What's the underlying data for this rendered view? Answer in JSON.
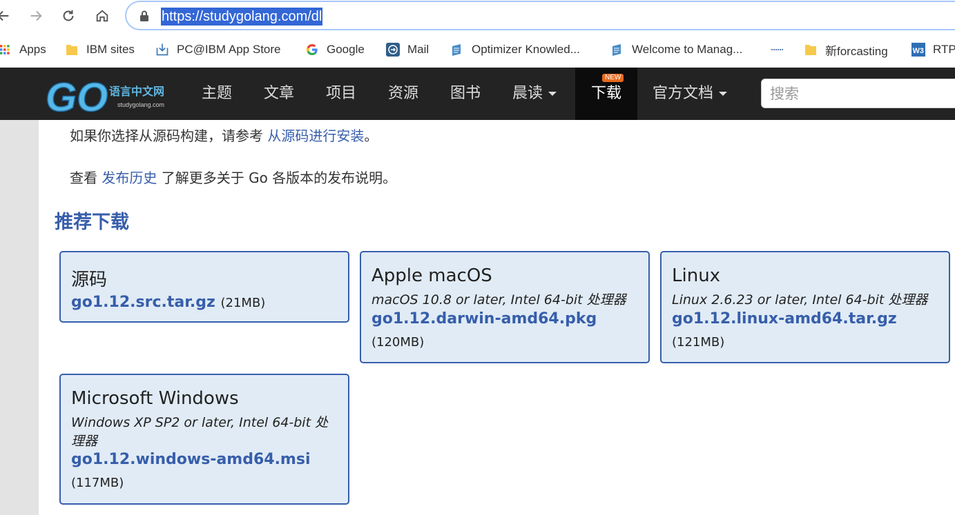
{
  "browser": {
    "url": "https://studygolang.com/dl",
    "bookmarks": [
      {
        "label": "Apps",
        "icon": "apps-grid-icon"
      },
      {
        "label": "IBM sites",
        "icon": "folder-icon"
      },
      {
        "label": "PC@IBM App Store",
        "icon": "download-tray-icon"
      },
      {
        "label": "Google",
        "icon": "google-icon"
      },
      {
        "label": "Mail",
        "icon": "mail-icon"
      },
      {
        "label": "Optimizer Knowled...",
        "icon": "page-icon"
      },
      {
        "label": "Welcome to Manag...",
        "icon": "page-icon"
      },
      {
        "label": "",
        "icon": "bookmark-line-icon"
      },
      {
        "label": "新forcasting",
        "icon": "folder-icon"
      },
      {
        "label": "RTP",
        "icon": "w3-icon"
      }
    ]
  },
  "site": {
    "logo_text": "GO",
    "logo_cn": "语言中文网",
    "logo_domain": "studygolang.com",
    "nav": [
      "主题",
      "文章",
      "项目",
      "资源",
      "图书",
      "晨读",
      "下载",
      "官方文档"
    ],
    "new_badge": "NEW",
    "search_placeholder": "搜索"
  },
  "content": {
    "p1_text": "如果你选择从源码构建，请参考 ",
    "p1_link": "从源码进行安装",
    "p1_end": "。",
    "p2_text": "查看 ",
    "p2_link": "发布历史",
    "p2_end": " 了解更多关于 Go 各版本的发布说明。",
    "section_title": "推荐下载",
    "downloads": [
      {
        "os": "源码",
        "desc": "",
        "file": "go1.12.src.tar.gz",
        "size": "(21MB)"
      },
      {
        "os": "Apple macOS",
        "desc": "macOS 10.8 or later, Intel 64-bit 处理器",
        "file": "go1.12.darwin-amd64.pkg",
        "size": "(120MB)"
      },
      {
        "os": "Linux",
        "desc": "Linux 2.6.23 or later, Intel 64-bit 处理器",
        "file": "go1.12.linux-amd64.tar.gz",
        "size": "(121MB)"
      },
      {
        "os": "Microsoft Windows",
        "desc": "Windows XP SP2 or later, Intel 64-bit 处理器",
        "file": "go1.12.windows-amd64.msi",
        "size": "(117MB)"
      }
    ]
  },
  "colors": {
    "accent": "#375eab",
    "card_bg": "#e0ebf5",
    "navbar": "#232323",
    "badge": "#e8691f"
  }
}
